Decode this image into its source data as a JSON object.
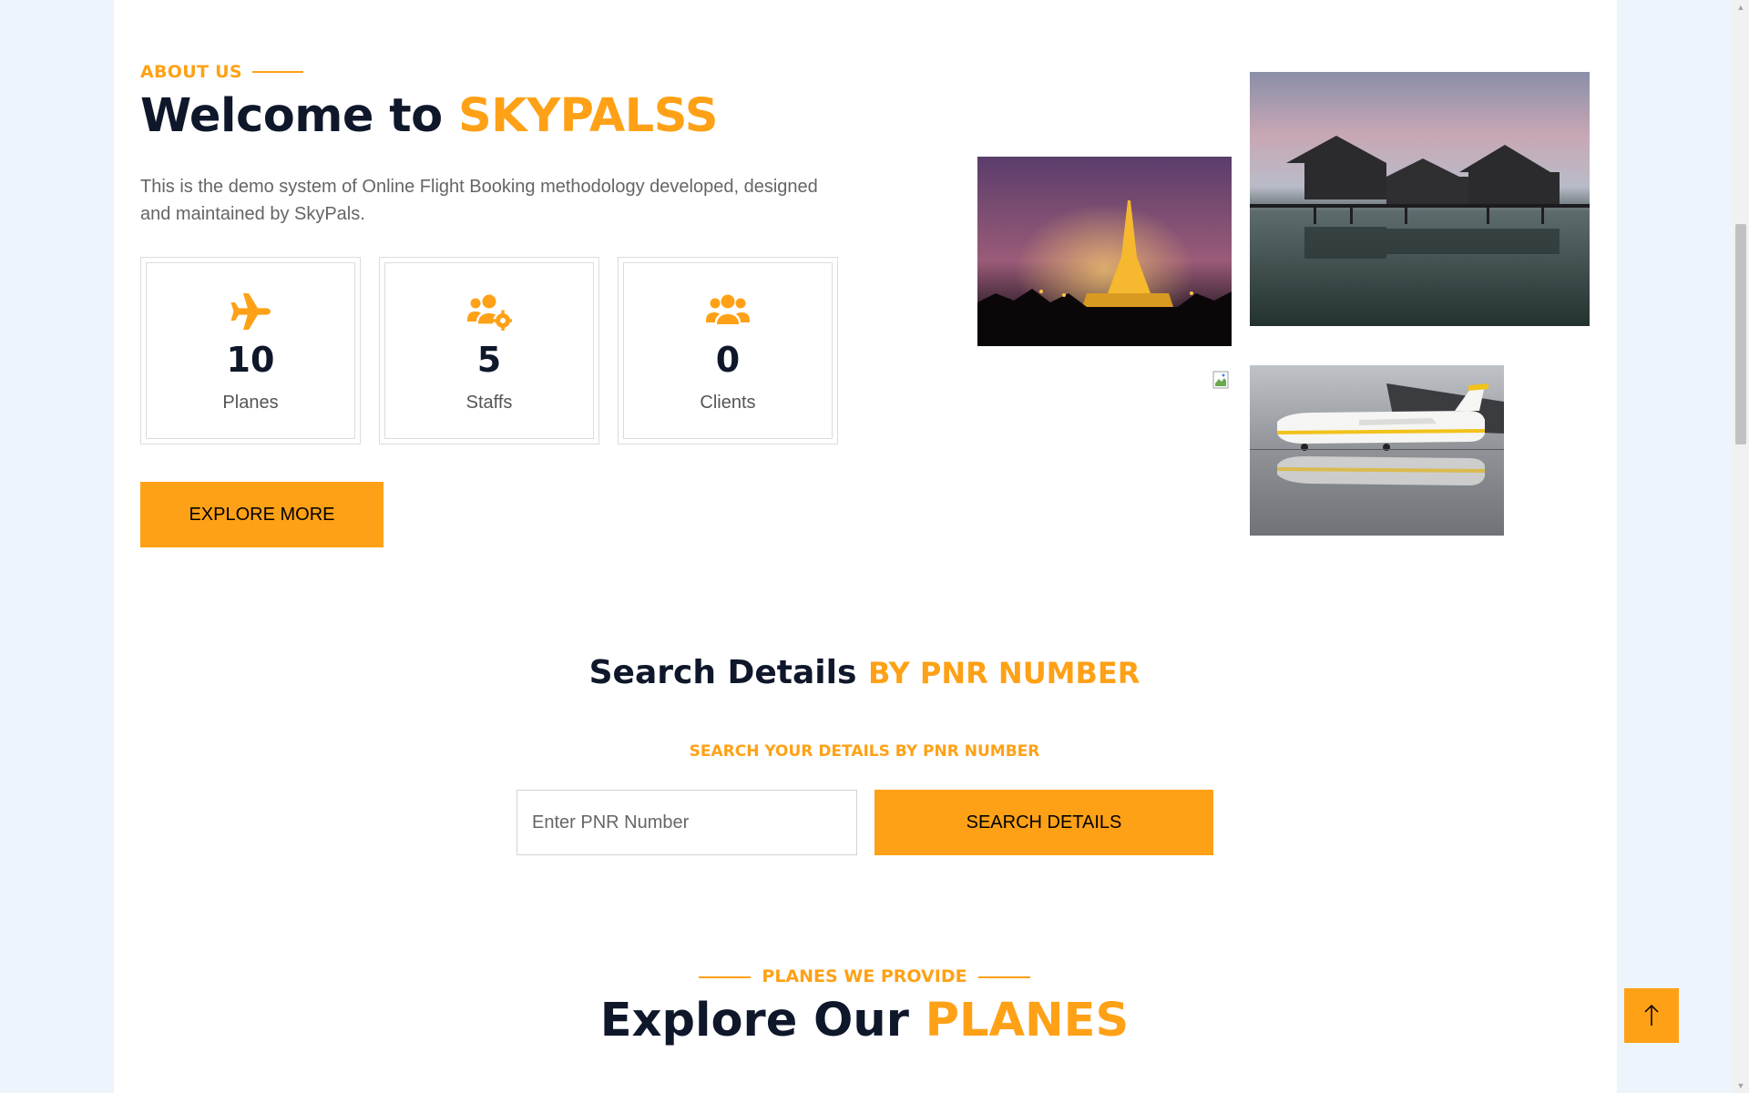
{
  "about": {
    "section_label": "ABOUT US",
    "title_prefix": "Welcome to ",
    "title_brand": "SKYPALSS",
    "description": "This is the demo system of Online Flight Booking methodology developed, designed and maintained by SkyPals.",
    "stats": [
      {
        "icon": "plane-icon",
        "value": "10",
        "label": "Planes"
      },
      {
        "icon": "users-cog-icon",
        "value": "5",
        "label": "Staffs"
      },
      {
        "icon": "users-icon",
        "value": "0",
        "label": "Clients"
      }
    ],
    "explore_button": "EXPLORE MORE"
  },
  "gallery": {
    "images": [
      "pagoda-night-photo",
      "stilt-house-lake-photo",
      "broken-image-icon",
      "airplane-reflection-photo"
    ]
  },
  "search": {
    "title_prefix": "Search Details ",
    "title_accent": "BY PNR NUMBER",
    "subtitle": "SEARCH YOUR DETAILS BY PNR NUMBER",
    "input_placeholder": "Enter PNR Number",
    "input_value": "",
    "button_label": "SEARCH DETAILS"
  },
  "planes": {
    "section_label": "PLANES WE PROVIDE",
    "title_prefix": "Explore Our ",
    "title_accent": "PLANES"
  },
  "colors": {
    "accent": "#fea116",
    "dark": "#0f172b",
    "background": "#eef4fb"
  },
  "back_to_top_icon": "arrow-up-icon"
}
